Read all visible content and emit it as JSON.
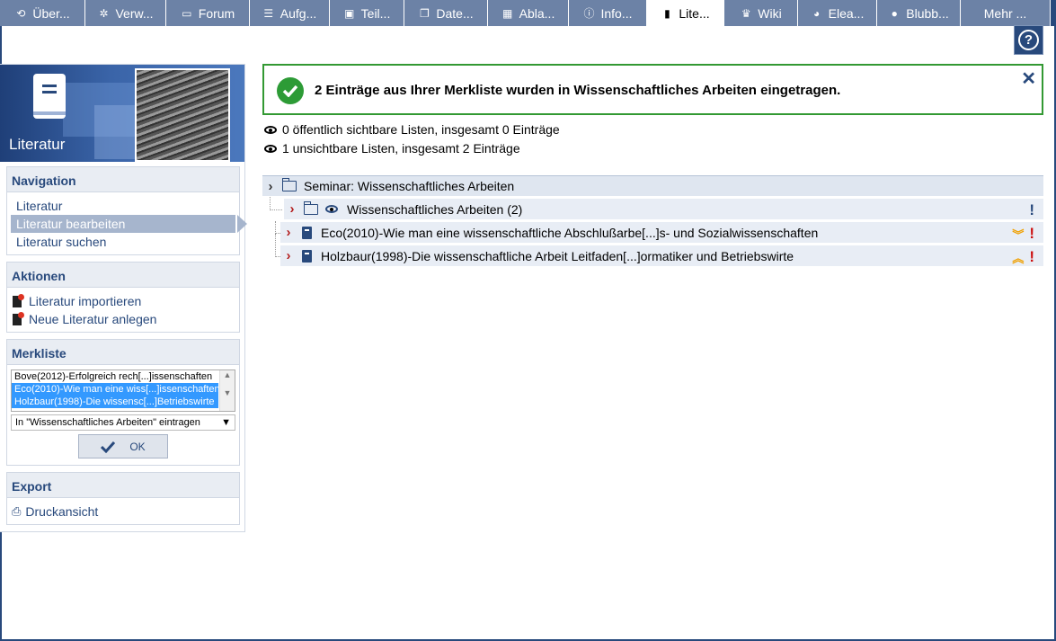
{
  "tabs": [
    {
      "label": "Über...",
      "icon": "overview-icon",
      "glyph": "⟲",
      "width": 95
    },
    {
      "label": "Verw...",
      "icon": "gears-icon",
      "glyph": "✲",
      "width": 90
    },
    {
      "label": "Forum",
      "icon": "forum-icon",
      "glyph": "▭",
      "width": 93
    },
    {
      "label": "Aufg...",
      "icon": "tasks-icon",
      "glyph": "☰",
      "width": 89
    },
    {
      "label": "Teil...",
      "icon": "participants-icon",
      "glyph": "▣",
      "width": 83
    },
    {
      "label": "Date...",
      "icon": "files-icon",
      "glyph": "❐",
      "width": 93
    },
    {
      "label": "Abla...",
      "icon": "schedule-icon",
      "glyph": "▦",
      "width": 90
    },
    {
      "label": "Info...",
      "icon": "info-icon",
      "glyph": "ⓘ",
      "width": 87
    },
    {
      "label": "Lite...",
      "icon": "book-icon",
      "glyph": "▮",
      "width": 86,
      "active": true
    },
    {
      "label": "Wiki",
      "icon": "wiki-icon",
      "glyph": "♛",
      "width": 82
    },
    {
      "label": "Elea...",
      "icon": "elearning-icon",
      "glyph": "◕",
      "width": 88
    },
    {
      "label": "Blubb...",
      "icon": "blubber-icon",
      "glyph": "●",
      "width": 93
    },
    {
      "label": "Mehr ...",
      "icon": "more-icon",
      "glyph": "",
      "width": 100
    }
  ],
  "sidebar": {
    "title": "Literatur",
    "navigation": {
      "heading": "Navigation",
      "items": [
        "Literatur",
        "Literatur bearbeiten",
        "Literatur suchen"
      ]
    },
    "actions": {
      "heading": "Aktionen",
      "items": [
        "Literatur importieren",
        "Neue Literatur anlegen"
      ]
    },
    "merkliste": {
      "heading": "Merkliste",
      "options": [
        "Bove(2012)-Erfolgreich rech[...]issenschaften",
        "Eco(2010)-Wie man eine wiss[...]issenschaften",
        "Holzbaur(1998)-Die wissensc[...]Betriebswirte"
      ],
      "select_value": "In \"Wissenschaftliches Arbeiten\" eintragen",
      "ok_label": "OK"
    },
    "export": {
      "heading": "Export",
      "items": [
        "Druckansicht"
      ]
    }
  },
  "main": {
    "message": "2 Einträge aus Ihrer Merkliste wurden in Wissenschaftliches Arbeiten eingetragen.",
    "public_lists": "0 öffentlich sichtbare Listen, insgesamt 0 Einträge",
    "hidden_lists": "1 unsichtbare Listen, insgesamt 2 Einträge",
    "tree": {
      "root": "Seminar: Wissenschaftliches Arbeiten",
      "list": "Wissenschaftliches Arbeiten (2)",
      "entries": [
        "Eco(2010)-Wie man eine wissenschaftliche Abschlußarbe[...]s- und Sozialwissenschaften",
        "Holzbaur(1998)-Die wissenschaftliche Arbeit Leitfaden[...]ormatiker und Betriebswirte"
      ]
    }
  },
  "colors": {
    "brand": "#28497c",
    "tab_inactive": "#6c82a6",
    "success": "#2d9b36",
    "alert": "#cc1111",
    "arrow": "#f0a000"
  }
}
